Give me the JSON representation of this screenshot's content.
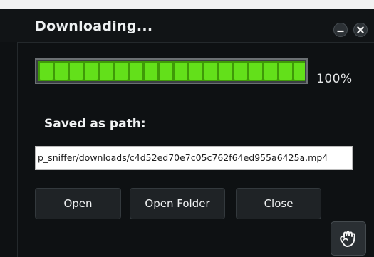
{
  "window": {
    "title": "Downloading..."
  },
  "progress": {
    "percent": 100,
    "percent_label": "100%",
    "fill_color": "#63e01a",
    "segments": 18
  },
  "path": {
    "label": "Saved as path:",
    "value": "p_sniffer/downloads/c4d52ed70e7c05c762f64ed955a6425a.mp4"
  },
  "buttons": {
    "open": "Open",
    "open_folder": "Open Folder",
    "close": "Close"
  },
  "icons": {
    "minimize": "minimize-icon",
    "close": "close-icon",
    "corner": "hand-icon"
  }
}
